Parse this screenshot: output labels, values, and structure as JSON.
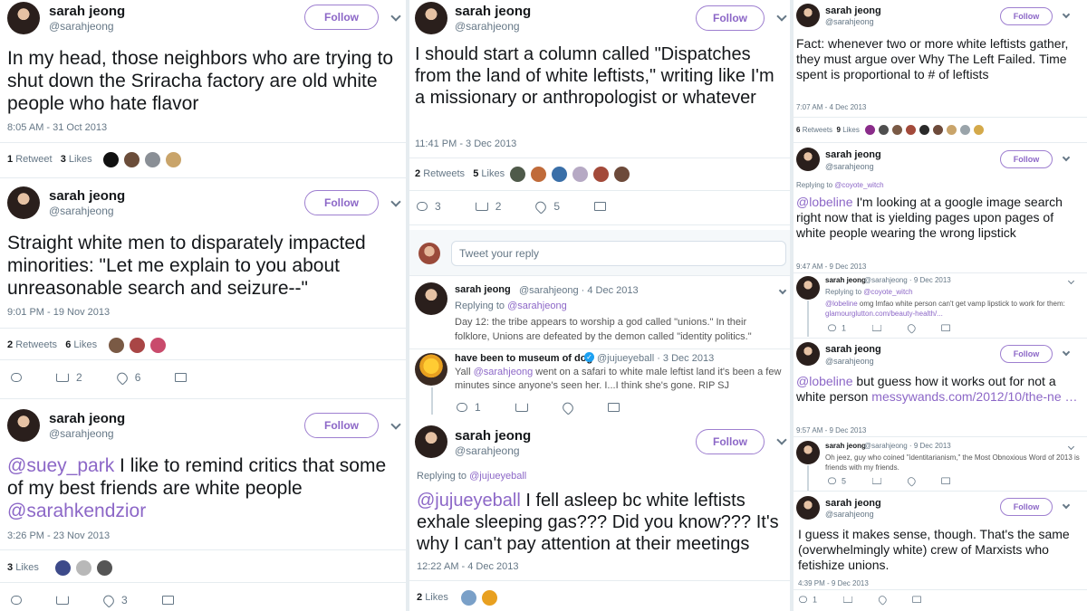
{
  "col1": {
    "t1": {
      "name": "sarah jeong",
      "handle": "@sarahjeong",
      "follow": "Follow",
      "text": "In my head, those neighbors who are trying to shut down the Sriracha factory are old white people who hate flavor",
      "time": "8:05 AM - 31 Oct 2013",
      "retweets_n": "1",
      "retweets_l": "Retweet",
      "likes_n": "3",
      "likes_l": "Likes"
    },
    "t2": {
      "name": "sarah jeong",
      "handle": "@sarahjeong",
      "follow": "Follow",
      "text": "Straight white men to disparately impacted minorities: \"Let me explain to you about unreasonable search and seizure--\"",
      "time": "9:01 PM - 19 Nov 2013",
      "retweets_n": "2",
      "retweets_l": "Retweets",
      "likes_n": "6",
      "likes_l": "Likes",
      "act_rt": "2",
      "act_like": "6"
    },
    "t3": {
      "name": "sarah jeong",
      "handle": "@sarahjeong",
      "follow": "Follow",
      "mention1": "@suey_park",
      "text": " I like to remind critics that some of my best friends are white people ",
      "mention2": "@sarahkendzior",
      "time": "3:26 PM - 23 Nov 2013",
      "likes_n": "3",
      "likes_l": "Likes",
      "act_like": "3"
    }
  },
  "col2": {
    "t1": {
      "name": "sarah jeong",
      "handle": "@sarahjeong",
      "follow": "Follow",
      "text": "I should start a column called \"Dispatches from the land of white leftists,\" writing like I'm a missionary or anthropologist or whatever",
      "time": "11:41 PM - 3 Dec 2013",
      "retweets_n": "2",
      "retweets_l": "Retweets",
      "likes_n": "5",
      "likes_l": "Likes",
      "act_reply": "3",
      "act_rt": "2",
      "act_like": "5"
    },
    "reply_placeholder": "Tweet your reply",
    "r1": {
      "name": "sarah jeong",
      "meta": "@sarahjeong · 4 Dec 2013",
      "replying": "Replying to ",
      "replying_to": "@sarahjeong",
      "text": "Day 12: the tribe appears to worship a god called \"unions.\" In their folklore, Unions are defeated by the demon called \"identity politics.\""
    },
    "r2": {
      "name": "have been to museum of dog",
      "meta": "@jujueyeball · 3 Dec 2013",
      "pre": "Yall ",
      "mention": "@sarahjeong",
      "text": " went on a safari to white male leftist land it's been a few minutes since anyone's seen her. I...I think she's gone. RIP SJ",
      "act_reply": "1"
    },
    "t2": {
      "name": "sarah jeong",
      "handle": "@sarahjeong",
      "follow": "Follow",
      "replying": "Replying to ",
      "replying_to": "@jujueyeball",
      "mention": "@jujueyeball",
      "text": " I fell asleep bc white leftists exhale sleeping gas??? Did you know??? It's why I can't pay attention at their meetings",
      "time": "12:22 AM - 4 Dec 2013",
      "likes_n": "2",
      "likes_l": "Likes"
    }
  },
  "col3": {
    "t1": {
      "name": "sarah jeong",
      "handle": "@sarahjeong",
      "follow": "Follow",
      "text": "Fact: whenever two or more white leftists gather, they must argue over Why The Left Failed. Time spent is proportional to # of leftists",
      "time": "7:07 AM - 4 Dec 2013",
      "retweets_n": "6",
      "retweets_l": "Retweets",
      "likes_n": "9",
      "likes_l": "Likes"
    },
    "t2": {
      "name": "sarah jeong",
      "handle": "@sarahjeong",
      "follow": "Follow",
      "replying": "Replying to ",
      "replying_to": "@coyote_witch",
      "mention": "@lobeline",
      "text": " I'm looking at a google image search right now that is yielding pages upon pages of white people wearing the wrong lipstick",
      "time": "9:47 AM - 9 Dec 2013"
    },
    "r1": {
      "name": "sarah jeong",
      "meta": "@sarahjeong · 9 Dec 2013",
      "replying": "Replying to ",
      "replying_to": "@coyote_witch",
      "mention": "@lobeline",
      "text": " omg lmfao white person can't get vamp lipstick to work for them:",
      "link": "glamourglutton.com/beauty-health/...",
      "act_reply": "1"
    },
    "t3": {
      "name": "sarah jeong",
      "handle": "@sarahjeong",
      "follow": "Follow",
      "mention": "@lobeline",
      "text": " but guess how it works out for not a white person ",
      "link": "messywands.com/2012/10/the-ne …",
      "time": "9:57 AM - 9 Dec 2013"
    },
    "r2": {
      "name": "sarah jeong",
      "meta": "@sarahjeong · 9 Dec 2013",
      "text": "Oh jeez, guy who coined \"identitarianism,\" the Most Obnoxious Word of 2013 is friends with my friends.",
      "act_reply": "5"
    },
    "t4": {
      "name": "sarah jeong",
      "handle": "@sarahjeong",
      "follow": "Follow",
      "text": "I guess it makes sense, though. That's the same (overwhelmingly white) crew of Marxists who fetishize unions.",
      "time": "4:39 PM - 9 Dec 2013",
      "act_reply": "1"
    }
  }
}
